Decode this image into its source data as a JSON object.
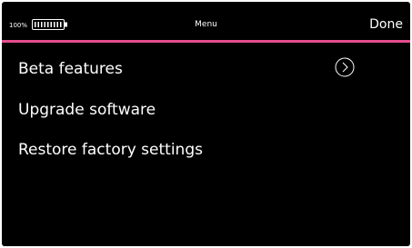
{
  "status": {
    "battery_percent": "100%",
    "battery_level": 1.0
  },
  "header": {
    "title": "Menu",
    "done_label": "Done"
  },
  "menu": {
    "items": [
      {
        "label": "Beta features",
        "icon": "chevron-right-circle-icon"
      },
      {
        "label": "Upgrade software"
      },
      {
        "label": "Restore factory settings"
      }
    ]
  },
  "colors": {
    "background": "#000000",
    "text": "#ffffff",
    "accent_divider": "#e64d8f"
  }
}
